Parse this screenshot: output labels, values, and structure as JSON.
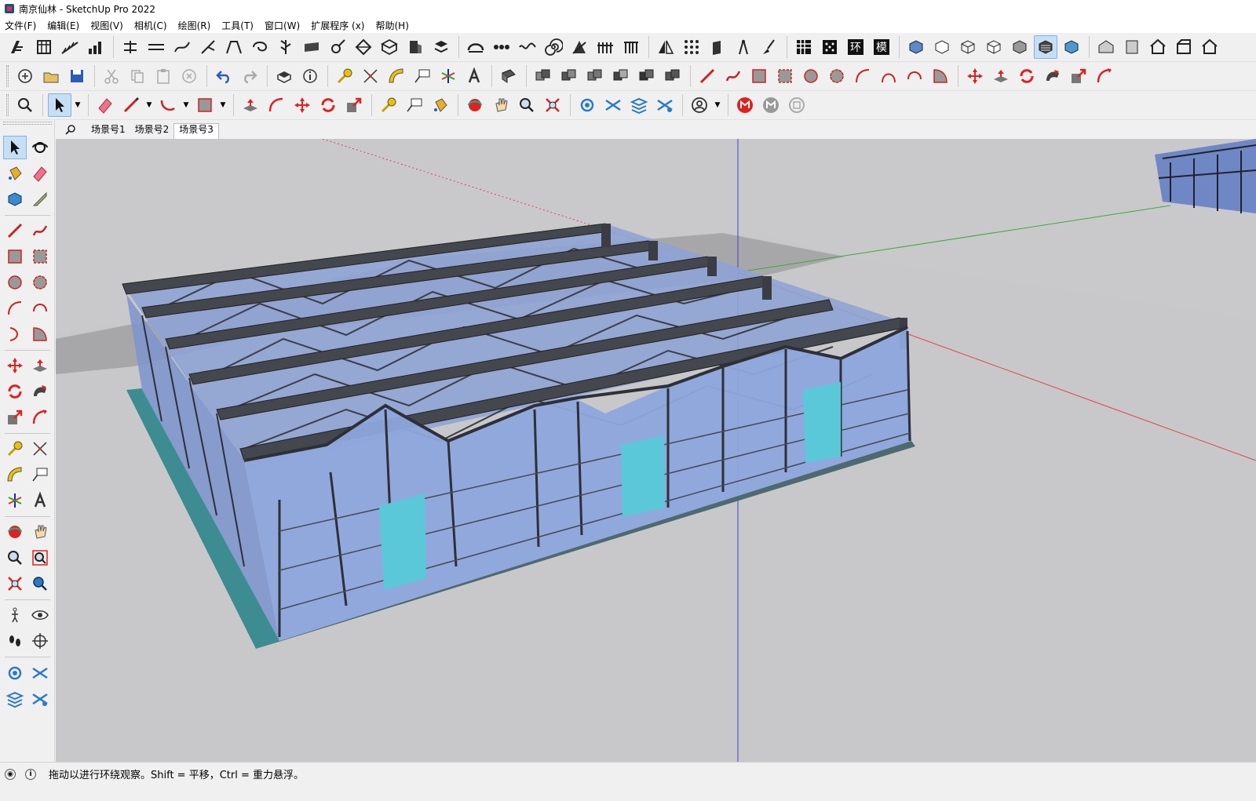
{
  "window": {
    "title": "南京仙林 - SketchUp Pro 2022"
  },
  "menu": [
    {
      "label": "文件(F)"
    },
    {
      "label": "编辑(E)"
    },
    {
      "label": "视图(V)"
    },
    {
      "label": "相机(C)"
    },
    {
      "label": "绘图(R)"
    },
    {
      "label": "工具(T)"
    },
    {
      "label": "窗口(W)"
    },
    {
      "label": "扩展程序 (x)"
    },
    {
      "label": "帮助(H)"
    }
  ],
  "toolbar_badges": {
    "env": "环",
    "model": "模"
  },
  "scenes": {
    "tabs": [
      {
        "label": "场景号1"
      },
      {
        "label": "场景号2"
      },
      {
        "label": "场景号3"
      }
    ],
    "current": "场景号3"
  },
  "left_tools": [
    "select-icon",
    "orbit-icon",
    "paint-bucket-icon",
    "eraser-icon",
    "component-icon",
    "tag-icon",
    "pencil-icon",
    "freehand-icon",
    "rectangle-icon",
    "rotated-rectangle-icon",
    "circle-icon",
    "polygon-icon",
    "arc-icon",
    "pie-icon",
    "two-point-arc-icon",
    "three-point-arc-icon",
    "move-icon",
    "push-pull-icon",
    "rotate-icon",
    "follow-me-icon",
    "scale-icon",
    "offset-icon",
    "tape-measure-icon",
    "text-icon",
    "protractor-icon",
    "3d-text-icon",
    "axes-icon",
    "dimension-icon",
    "orbit-red-icon",
    "pan-icon",
    "zoom-icon",
    "zoom-window-icon",
    "zoom-extents-icon",
    "previous-view-icon",
    "walk-icon",
    "look-around-icon",
    "footprints-icon",
    "position-camera-icon",
    "section-plane-icon",
    "section-display-icon",
    "section-fill-icon",
    "section-cut-icon"
  ],
  "status": {
    "hint": "拖动以进行环绕观察。Shift = 平移，Ctrl = 重力悬浮。"
  },
  "colors": {
    "viewport_bg": "#c9c9cc",
    "glass": "#8fa8e0",
    "frame": "#3b3e44",
    "axis_red": "#d43c3c",
    "axis_green": "#3caa3c",
    "axis_blue": "#3c3cd4"
  }
}
